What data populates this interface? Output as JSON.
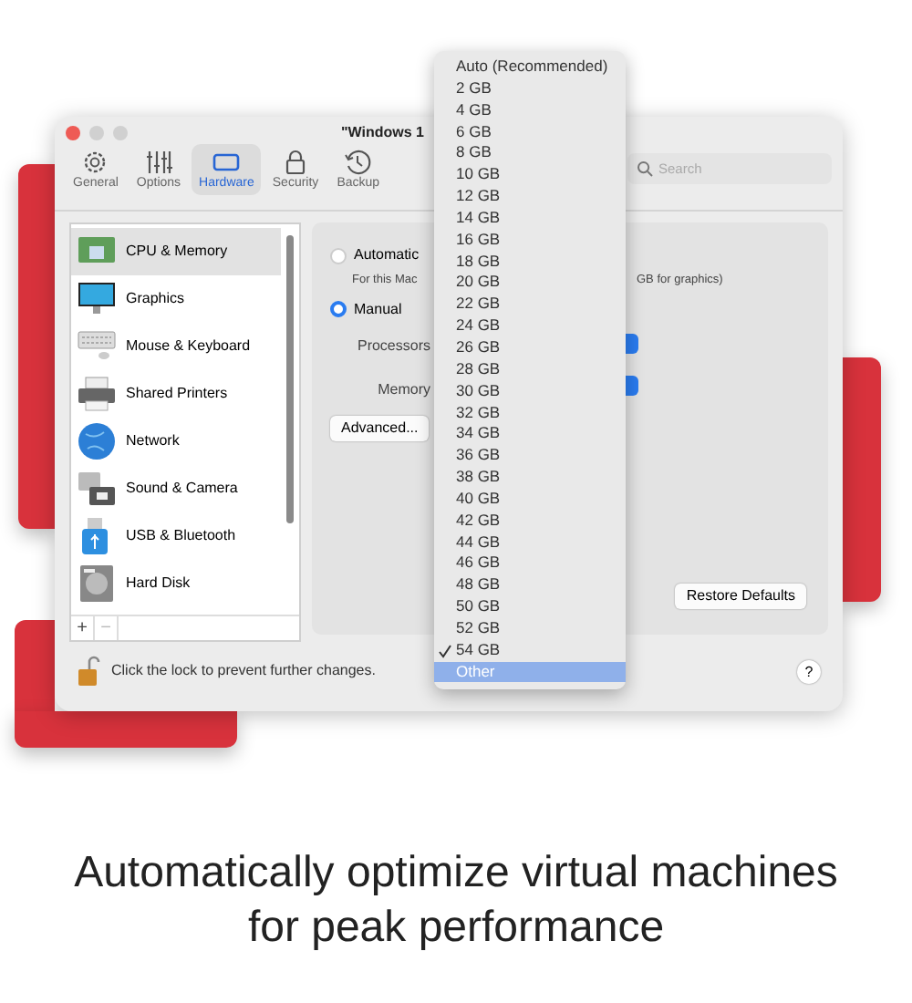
{
  "window": {
    "title": "\"Windows 1"
  },
  "toolbar": [
    {
      "label": "General",
      "kind": "gear",
      "selected": false
    },
    {
      "label": "Options",
      "kind": "sliders",
      "selected": false
    },
    {
      "label": "Hardware",
      "kind": "chip",
      "selected": true
    },
    {
      "label": "Security",
      "kind": "lock",
      "selected": false
    },
    {
      "label": "Backup",
      "kind": "clock",
      "selected": false
    }
  ],
  "search": {
    "placeholder": "Search"
  },
  "sidebar": {
    "items": [
      {
        "label": "CPU & Memory",
        "kind": "cpu",
        "selected": true
      },
      {
        "label": "Graphics",
        "kind": "display",
        "selected": false
      },
      {
        "label": "Mouse & Keyboard",
        "kind": "keyboard",
        "selected": false
      },
      {
        "label": "Shared Printers",
        "kind": "printer",
        "selected": false
      },
      {
        "label": "Network",
        "kind": "network",
        "selected": false
      },
      {
        "label": "Sound & Camera",
        "kind": "sound",
        "selected": false
      },
      {
        "label": "USB & Bluetooth",
        "kind": "usb",
        "selected": false
      },
      {
        "label": "Hard Disk",
        "kind": "disk",
        "selected": false
      }
    ],
    "add_button": "+",
    "remove_button": "−"
  },
  "panel": {
    "radios": [
      {
        "label": "Automatic",
        "selected": false
      },
      {
        "label": "Manual",
        "selected": true
      }
    ],
    "note": "For this Mac",
    "note_tail": "GB for graphics)",
    "processors_label": "Processors",
    "memory_label": "Memory",
    "advanced_button": "Advanced...",
    "restore_button": "Restore Defaults"
  },
  "memory_menu": [
    {
      "label": "Auto (Recommended)",
      "checked": false,
      "highlighted": false
    },
    {
      "label": "2 GB",
      "checked": false,
      "highlighted": false
    },
    {
      "label": "4 GB",
      "checked": false,
      "highlighted": false
    },
    {
      "label": "6 GB",
      "checked": false,
      "highlighted": false
    },
    {
      "label": "8 GB",
      "checked": false,
      "highlighted": false
    },
    {
      "label": "10 GB",
      "checked": false,
      "highlighted": false
    },
    {
      "label": "12 GB",
      "checked": false,
      "highlighted": false
    },
    {
      "label": "14 GB",
      "checked": false,
      "highlighted": false
    },
    {
      "label": "16 GB",
      "checked": false,
      "highlighted": false
    },
    {
      "label": "18 GB",
      "checked": false,
      "highlighted": false
    },
    {
      "label": "20 GB",
      "checked": false,
      "highlighted": false
    },
    {
      "label": "22 GB",
      "checked": false,
      "highlighted": false
    },
    {
      "label": "24 GB",
      "checked": false,
      "highlighted": false
    },
    {
      "label": "26 GB",
      "checked": false,
      "highlighted": false
    },
    {
      "label": "28 GB",
      "checked": false,
      "highlighted": false
    },
    {
      "label": "30 GB",
      "checked": false,
      "highlighted": false
    },
    {
      "label": "32 GB",
      "checked": false,
      "highlighted": false
    },
    {
      "label": "34 GB",
      "checked": false,
      "highlighted": false
    },
    {
      "label": "36 GB",
      "checked": false,
      "highlighted": false
    },
    {
      "label": "38 GB",
      "checked": false,
      "highlighted": false
    },
    {
      "label": "40 GB",
      "checked": false,
      "highlighted": false
    },
    {
      "label": "42 GB",
      "checked": false,
      "highlighted": false
    },
    {
      "label": "44 GB",
      "checked": false,
      "highlighted": false
    },
    {
      "label": "46 GB",
      "checked": false,
      "highlighted": false
    },
    {
      "label": "48 GB",
      "checked": false,
      "highlighted": false
    },
    {
      "label": "50 GB",
      "checked": false,
      "highlighted": false
    },
    {
      "label": "52 GB",
      "checked": false,
      "highlighted": false
    },
    {
      "label": "54 GB",
      "checked": true,
      "highlighted": false
    },
    {
      "label": "Other",
      "checked": false,
      "highlighted": true
    }
  ],
  "status": {
    "lock_text": "Click the lock to prevent further changes.",
    "help_button": "?"
  },
  "caption": [
    "Automatically optimize virtual machines",
    "for peak performance"
  ]
}
